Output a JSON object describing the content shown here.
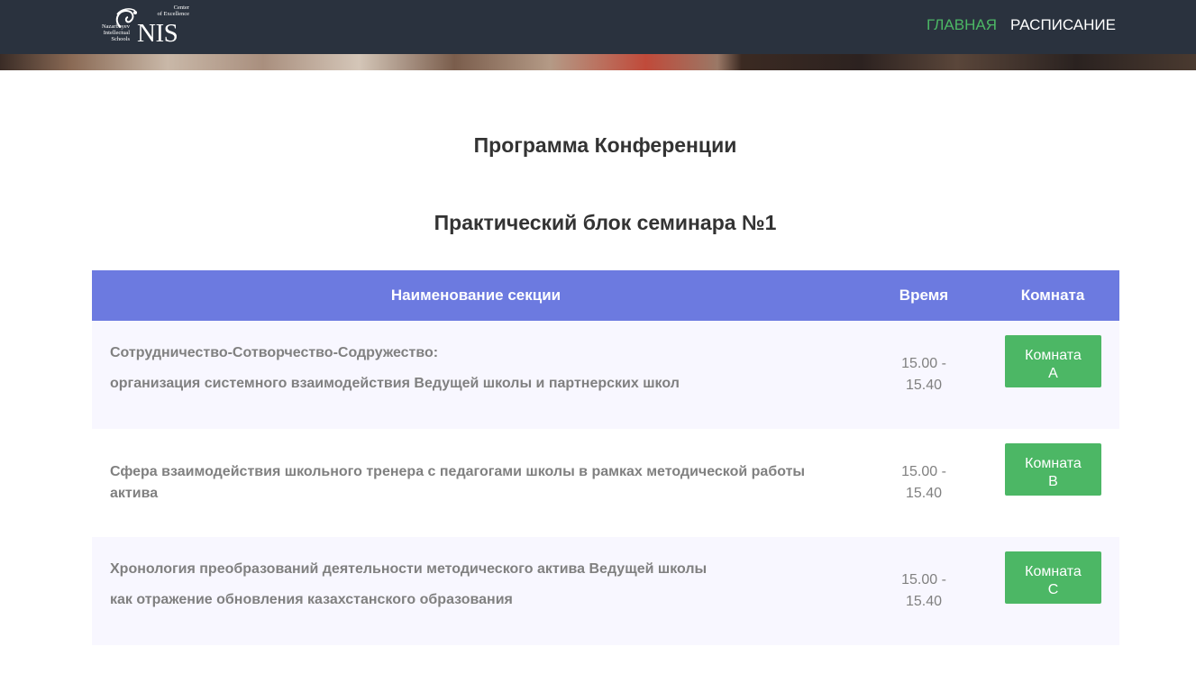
{
  "logo": {
    "left_text": [
      "Nazarbayev",
      "Intellectual",
      "Schools"
    ],
    "top_text": [
      "Center",
      "of Excellence"
    ],
    "mark": "NIS"
  },
  "nav": {
    "home": "ГЛАВНАЯ",
    "schedule": "РАСПИСАНИЕ"
  },
  "page": {
    "title": "Программа Конференции",
    "subtitle": "Практический блок семинара №1"
  },
  "table": {
    "headers": {
      "name": "Наименование секции",
      "time": "Время",
      "room": "Комната"
    },
    "rows": [
      {
        "title_lines": [
          "Сотрудничество-Сотворчество-Содружество:",
          "организация системного взаимодействия Ведущей школы и партнерских школ"
        ],
        "time_lines": [
          "15.00  -",
          "15.40"
        ],
        "room_lines": [
          "Комната",
          "А"
        ]
      },
      {
        "title_lines": [
          "Сфера взаимодействия школьного тренера с педагогами школы в рамках методической работы",
          "актива"
        ],
        "time_lines": [
          "15.00  -",
          "15.40"
        ],
        "room_lines": [
          "Комната",
          "В"
        ]
      },
      {
        "title_lines": [
          "Хронология преобразований деятельности методического актива Ведущей школы",
          "как отражение обновления казахстанского образования"
        ],
        "time_lines": [
          "15.00  -",
          "15.40"
        ],
        "room_lines": [
          "Комната",
          "С"
        ]
      }
    ]
  },
  "colors": {
    "navbar": "#2a323e",
    "accent_green": "#4cb765",
    "table_header": "#6c7ae0",
    "row_tint": "#f8f7ff",
    "muted_text": "#808080"
  }
}
